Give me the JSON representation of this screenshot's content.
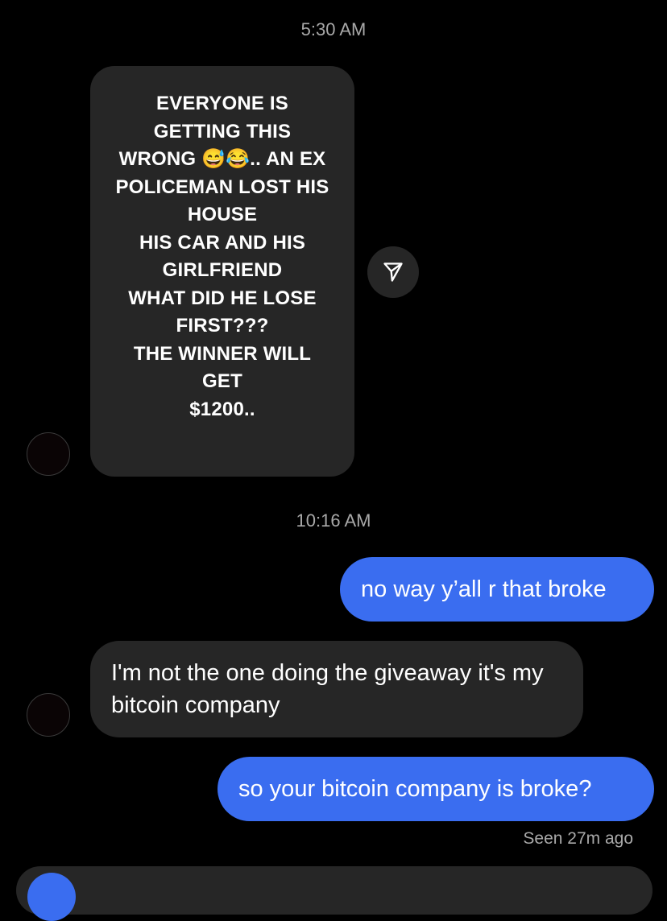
{
  "thread": {
    "timestamp_1": "5:30 AM",
    "timestamp_2": "10:16 AM",
    "story_lines": [
      "EVERYONE IS",
      "GETTING THIS",
      "WRONG 😅😂.. AN EX",
      "POLICEMAN LOST HIS",
      "HOUSE",
      "HIS CAR AND HIS",
      "GIRLFRIEND",
      "WHAT DID HE LOSE",
      "FIRST???",
      "THE WINNER WILL",
      "GET",
      "$1200.."
    ],
    "messages": [
      {
        "side": "sent",
        "text": "no way y’all r that broke"
      },
      {
        "side": "received",
        "text": "I'm not the one doing the giveaway it's my bitcoin company"
      },
      {
        "side": "sent",
        "text": "so your bitcoin company is broke?"
      }
    ],
    "seen_status": "Seen 27m ago",
    "icons": {
      "share": "paper-plane-icon"
    },
    "colors": {
      "sent_bubble": "#3a6df0",
      "received_bubble": "#262626",
      "background": "#000000"
    }
  }
}
